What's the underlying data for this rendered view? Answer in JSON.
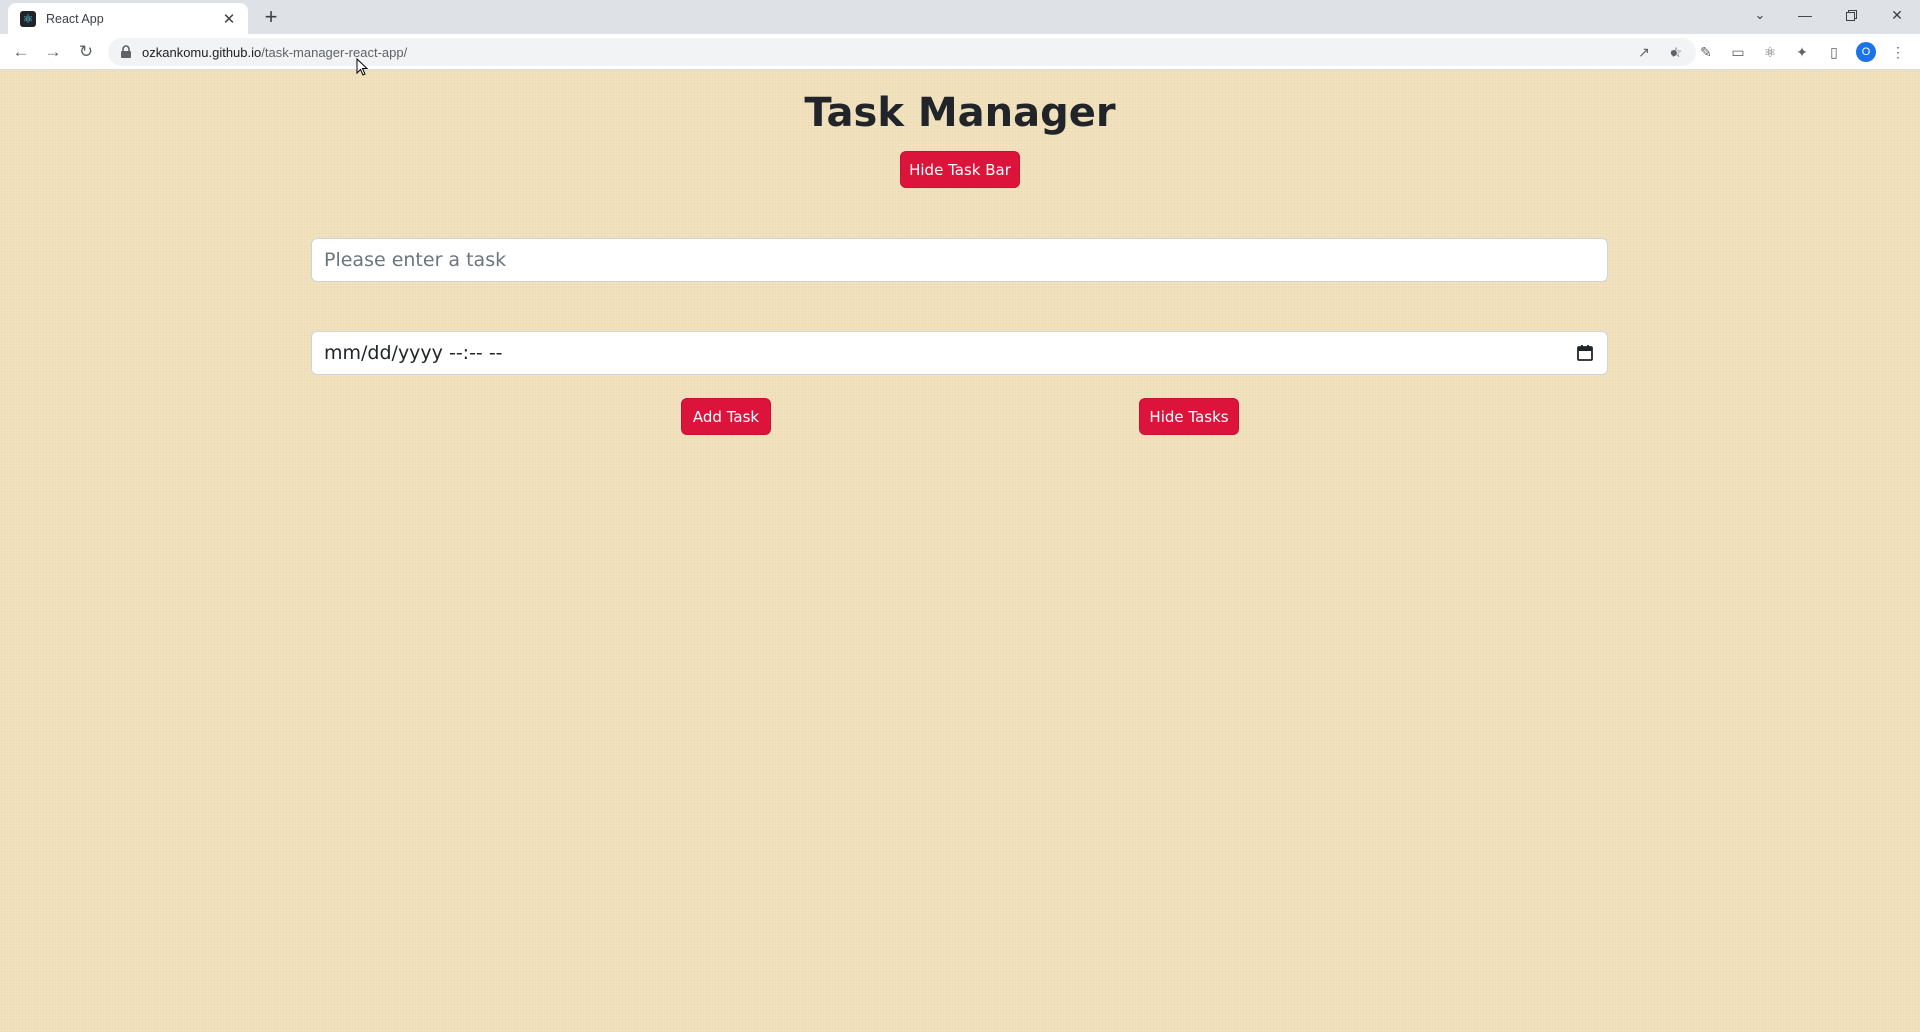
{
  "browser": {
    "tab_title": "React App",
    "tab_close_glyph": "✕",
    "new_tab_glyph": "+",
    "url_host": "ozkankomu.github.io",
    "url_path": "/task-manager-react-app/",
    "profile_initial": "O",
    "icons": {
      "favicon": "react-logo-icon",
      "back": "arrow-left-icon",
      "forward": "arrow-right-icon",
      "reload": "reload-icon",
      "lock": "lock-icon",
      "share": "share-icon",
      "bookmark": "star-icon",
      "extensions": "puzzle-icon",
      "side_panel": "side-panel-icon",
      "menu": "kebab-menu-icon",
      "tab_search": "chevron-down-icon",
      "minimize": "minimize-icon",
      "maximize": "restore-icon",
      "close": "close-icon"
    }
  },
  "app": {
    "title": "Task Manager",
    "hide_task_bar_label": "Hide Task Bar",
    "task_input_placeholder": "Please enter a task",
    "date_input_value": "mm/dd/yyyy --:-- --",
    "add_task_label": "Add Task",
    "hide_tasks_label": "Hide Tasks"
  },
  "colors": {
    "page_background": "#f2e3be",
    "button_accent": "#dc143c",
    "title_text": "#212529"
  }
}
